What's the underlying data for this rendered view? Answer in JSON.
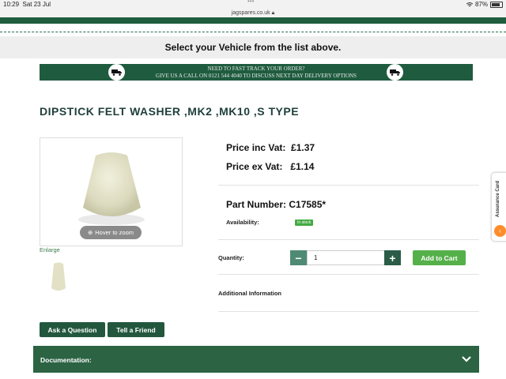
{
  "status_bar": {
    "time": "10:29",
    "date": "Sat 23 Jul",
    "battery": "87%",
    "battery_level": 0.87,
    "url": "jagspares.co.uk"
  },
  "vehicle_banner": "Select your Vehicle from the list above.",
  "fast_track": {
    "line1": "Need to fast track your order?",
    "line2": "Give us a call on 0121 544 4040 to discuss next day delivery options"
  },
  "product": {
    "title": "DIPSTICK FELT WASHER ,MK2 ,MK10 ,S TYPE",
    "zoom_label": "Hover to zoom",
    "enlarge_label": "Enlarge",
    "price_inc_label": "Price inc Vat:",
    "price_inc": "£1.37",
    "price_ex_label": "Price ex Vat:",
    "price_ex": "£1.14",
    "part_number_label": "Part Number:",
    "part_number": "C17585*",
    "availability_label": "Availability:",
    "availability": "In stock",
    "quantity_label": "Quantity:",
    "quantity": "1",
    "add_to_cart": "Add to Cart",
    "additional_info": "Additional Information"
  },
  "buttons": {
    "ask_question": "Ask a Question",
    "tell_friend": "Tell a Friend"
  },
  "documentation": {
    "label": "Documentation:"
  },
  "side_badge": {
    "label": "Assurance Card"
  },
  "colors": {
    "brand_green": "#1f5c3f",
    "cart_green": "#55b04a",
    "title_color": "#1f3f3a"
  },
  "icons": {
    "truck": "truck-icon",
    "zoom": "zoom-icon",
    "chevron": "chevron-down-icon",
    "wifi": "wifi-icon"
  }
}
